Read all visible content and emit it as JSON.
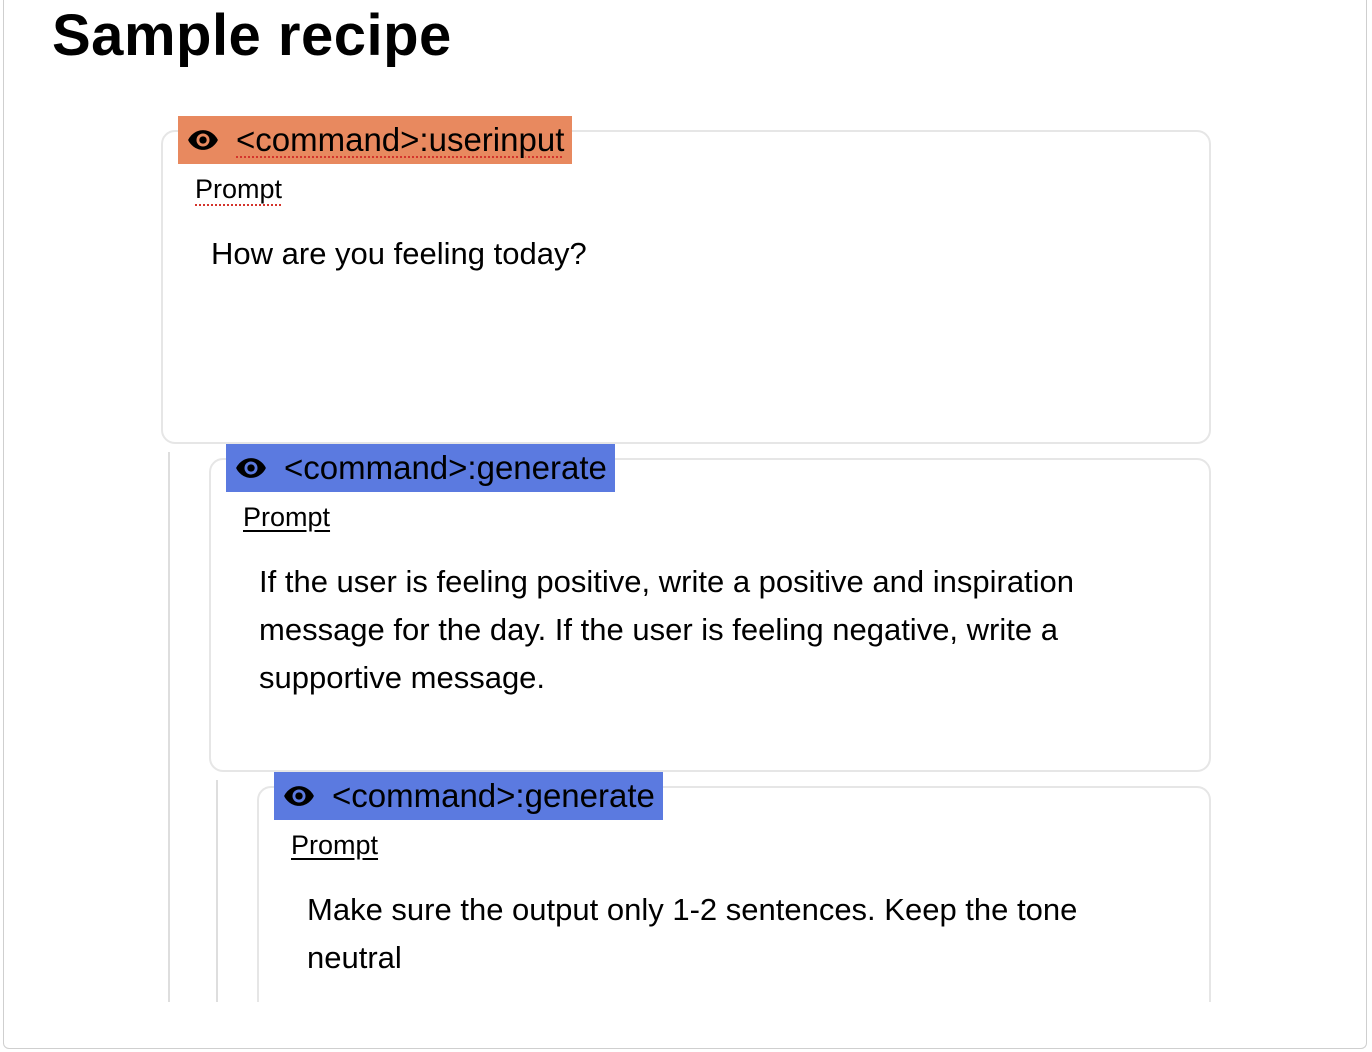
{
  "page": {
    "title": "Sample recipe"
  },
  "steps": [
    {
      "command": "<command>:userinput",
      "tag_color": "#e8895f",
      "prompt_label": "Prompt",
      "prompt_text": "How are you feeling today?",
      "icon": "eye-icon"
    },
    {
      "command": "<command>:generate",
      "tag_color": "#5b7ae0",
      "prompt_label": "Prompt",
      "prompt_text": "If the user is feeling positive, write a positive and inspiration message for the day. If the user is feeling negative, write a supportive message.",
      "icon": "eye-icon"
    },
    {
      "command": "<command>:generate",
      "tag_color": "#5b7ae0",
      "prompt_label": "Prompt",
      "prompt_text": "Make sure the output only 1-2 sentences. Keep the tone neutral",
      "icon": "eye-icon"
    }
  ]
}
